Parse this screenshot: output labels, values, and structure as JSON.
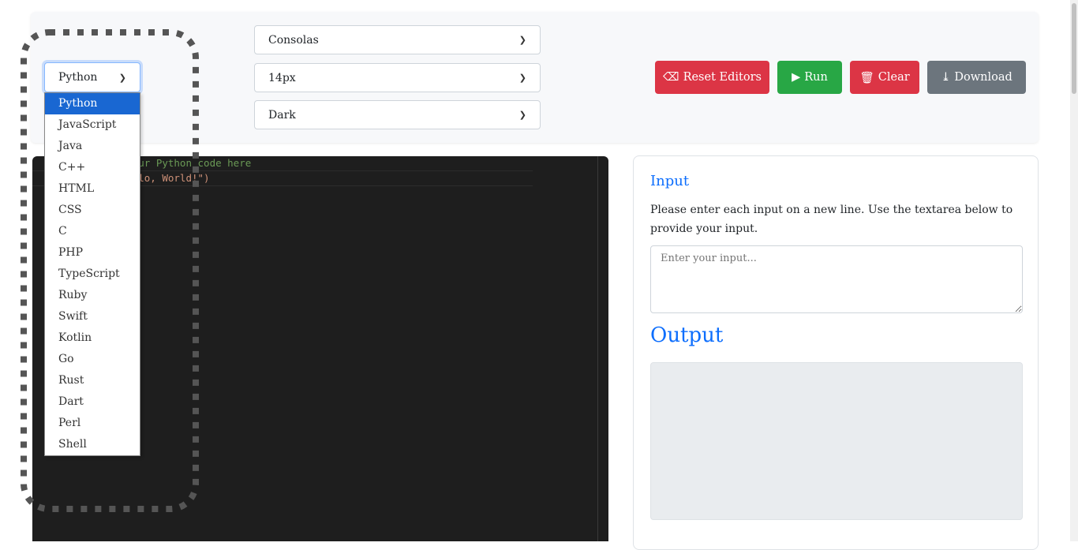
{
  "toolbar": {
    "language": "Python",
    "font_family": "Consolas",
    "font_size": "14px",
    "theme": "Dark",
    "buttons": {
      "reset": "Reset Editors",
      "run": "Run",
      "clear": "Clear",
      "download": "Download"
    },
    "colors": {
      "reset": "#dc3545",
      "run": "#28a745",
      "clear": "#dc3545",
      "download": "#6c757d"
    }
  },
  "language_options": [
    "Python",
    "JavaScript",
    "Java",
    "C++",
    "HTML",
    "CSS",
    "C",
    "PHP",
    "TypeScript",
    "Ruby",
    "Swift",
    "Kotlin",
    "Go",
    "Rust",
    "Dart",
    "Perl",
    "Shell"
  ],
  "editor": {
    "lines": [
      "# Write your Python code here",
      "print(\"Hello, World!\")"
    ]
  },
  "input": {
    "title": "Input",
    "description": "Please enter each input on a new line. Use the textarea below to provide your input.",
    "placeholder": "Enter your input..."
  },
  "output": {
    "title": "Output"
  }
}
